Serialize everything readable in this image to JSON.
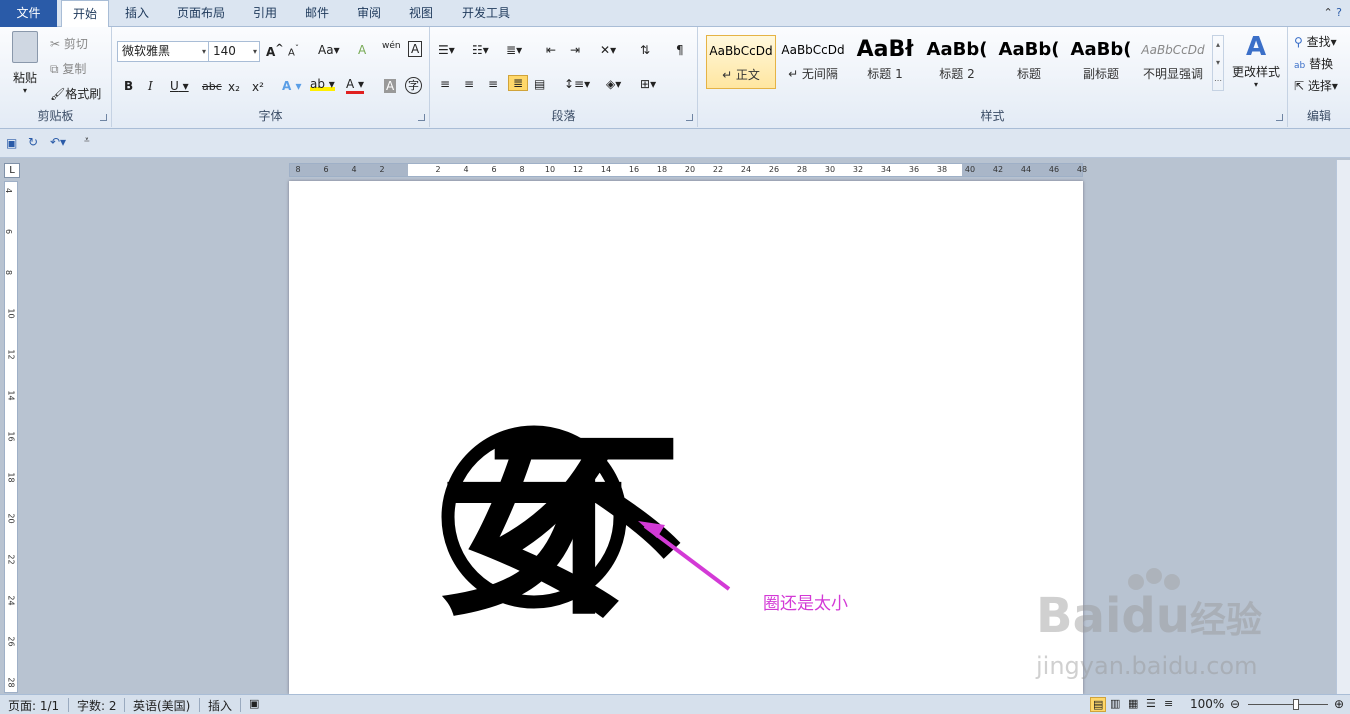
{
  "tabs": [
    "文件",
    "开始",
    "插入",
    "页面布局",
    "引用",
    "邮件",
    "审阅",
    "视图",
    "开发工具"
  ],
  "ribbon": {
    "clipboard": {
      "paste": "粘贴",
      "cut": "剪切",
      "copy": "复制",
      "format_painter": "格式刷",
      "label": "剪贴板"
    },
    "font": {
      "font_name": "微软雅黑",
      "font_size": "140",
      "grow": "A",
      "shrink": "A",
      "change_case": "Aa",
      "clear": "A",
      "phonetic": "wén",
      "border_char": "A",
      "bold": "B",
      "italic": "I",
      "underline": "U",
      "strike": "abc",
      "subscript": "x₂",
      "superscript": "x²",
      "text_effect": "A",
      "highlight": "ab",
      "font_color": "A",
      "char_shading": "A",
      "enclose": "字",
      "label": "字体"
    },
    "paragraph": {
      "label": "段落"
    },
    "styles": {
      "items": [
        {
          "sample": "AaBbCcDd",
          "name": "↵ 正文"
        },
        {
          "sample": "AaBbCcDd",
          "name": "↵ 无间隔"
        },
        {
          "sample": "AaBł",
          "name": "标题 1"
        },
        {
          "sample": "AaBb(",
          "name": "标题 2"
        },
        {
          "sample": "AaBb(",
          "name": "标题"
        },
        {
          "sample": "AaBb(",
          "name": "副标题"
        },
        {
          "sample": "AaBbCcDd",
          "name": "不明显强调"
        }
      ],
      "change_styles": "更改样式",
      "label": "样式"
    },
    "editing": {
      "find": "查找",
      "replace": "替换",
      "select": "选择",
      "label": "编辑"
    }
  },
  "ruler_h": [
    "8",
    "6",
    "4",
    "2",
    "",
    "2",
    "4",
    "6",
    "8",
    "10",
    "12",
    "14",
    "16",
    "18",
    "20",
    "22",
    "24",
    "26",
    "28",
    "30",
    "32",
    "34",
    "36",
    "38",
    "40",
    "42",
    "44",
    "46",
    "48"
  ],
  "ruler_v": [
    "4",
    "6",
    "8",
    "10",
    "12",
    "14",
    "16",
    "18",
    "20",
    "22",
    "24",
    "26",
    "28"
  ],
  "document": {
    "enclosed_char_a": "女",
    "enclosed_char_b": "不",
    "annotation": "圈还是太小"
  },
  "watermark": {
    "brand": "Baidu",
    "brand_cn": "经验",
    "url": "jingyan.baidu.com"
  },
  "status": {
    "page": "页面: 1/1",
    "words": "字数: 2",
    "lang": "英语(美国)",
    "mode": "插入",
    "zoom": "100%"
  },
  "colors": {
    "annotation": "#d33ad6",
    "file_tab": "#2a5ba8"
  }
}
